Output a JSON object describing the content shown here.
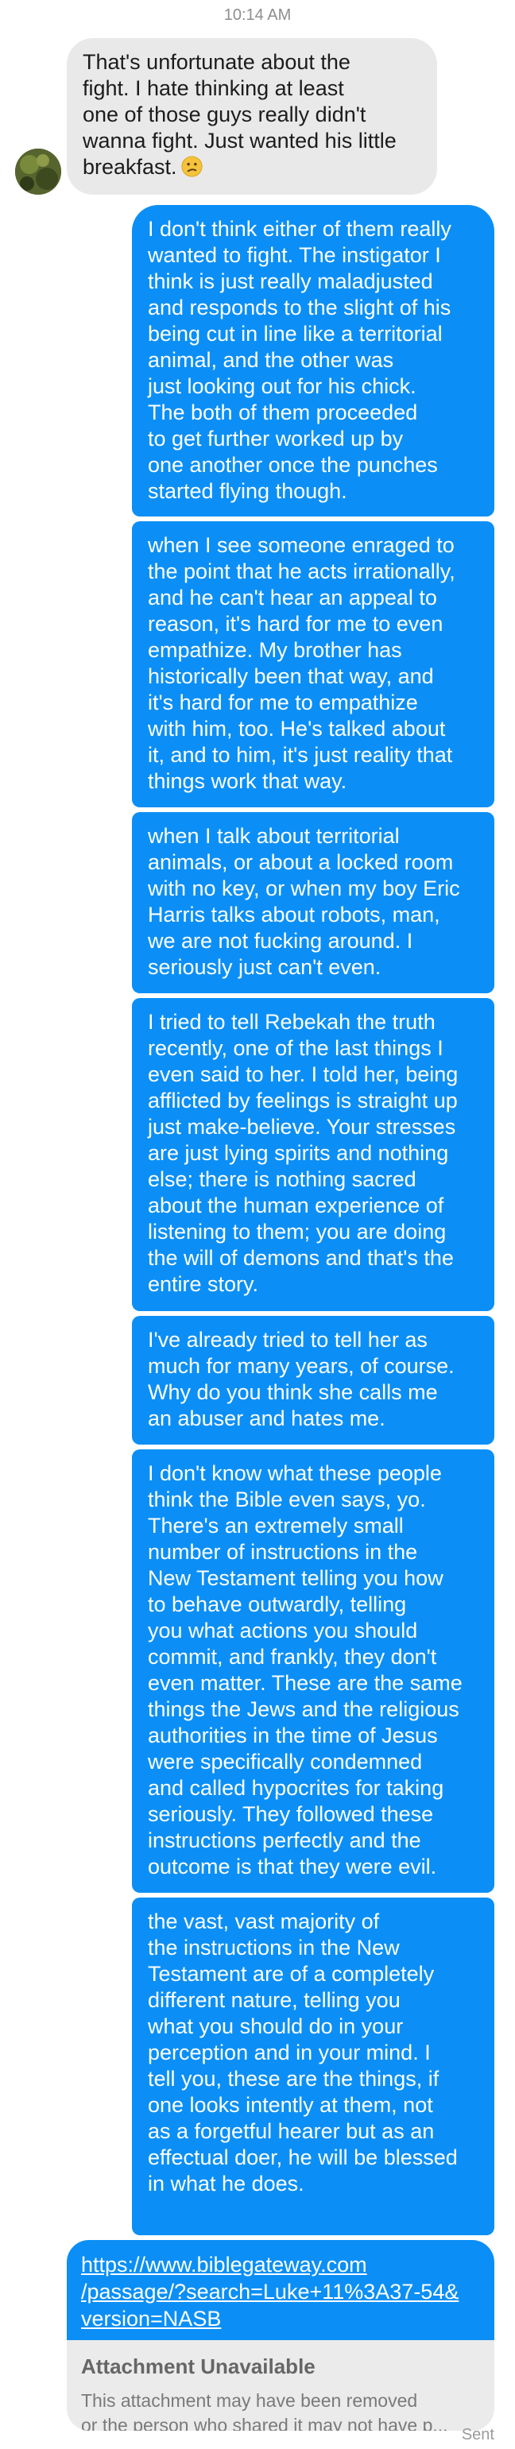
{
  "timestamp": "10:14 AM",
  "incoming": {
    "text": "That's unfortunate about the\nfight. I hate thinking at least\none of those guys really didn't\nwanna fight. Just wanted his little\nbreakfast.",
    "emoji": "confused-face"
  },
  "outgoing": [
    "I don't think either of them really\nwanted to fight. The instigator I\nthink is just really maladjusted\nand responds to the slight of his\nbeing cut in line like a territorial\nanimal, and the other was\njust looking out for his chick.\nThe both of them proceeded\nto get further worked up by\none another once the punches\nstarted flying though.",
    "when I see someone enraged to\nthe point that he acts irrationally,\nand he can't hear an appeal to\nreason, it's hard for me to even\nempathize. My brother has\nhistorically been that way, and\nit's hard for me to empathize\nwith him, too. He's talked about\nit, and to him, it's just reality that\nthings work that way.",
    "when I talk about territorial\nanimals, or about a locked room\nwith no key, or when my boy Eric\nHarris talks about robots, man,\nwe are not fucking around. I\nseriously just can't even.",
    "I tried to tell Rebekah the truth\nrecently, one of the last things I\neven said to her. I told her, being\nafflicted by feelings is straight up\njust make-believe. Your stresses\nare just lying spirits and nothing\nelse; there is nothing sacred\nabout the human experience of\nlistening to them; you are doing\nthe will of demons and that's the\nentire story.",
    "I've already tried to tell her as\nmuch for many years, of course.\nWhy do you think she calls me\nan abuser and hates me.",
    "I don't know what these people\nthink the Bible even says, yo.\nThere's an extremely small\nnumber of instructions in the\nNew Testament telling you how\nto behave outwardly, telling\nyou what actions you should\ncommit, and frankly, they don't\neven matter. These are the same\nthings the Jews and the religious\nauthorities in the time of Jesus\nwere specifically condemned\nand called hypocrites for taking\nseriously. They followed these\ninstructions perfectly and the\noutcome is that they were evil.",
    "the vast, vast majority of\nthe instructions in the New\nTestament are of a completely\ndifferent nature, telling you\nwhat you should do in your\nperception and in your mind. I\ntell you, these are the things, if\none looks intently at them, not\nas a forgetful hearer but as an\neffectual doer, he will be blessed\nin what he does."
  ],
  "link": {
    "line1": "https://www.biblegateway.com",
    "line2": "/passage/?search=Luke+11%3A37-54&",
    "line3": "version=NASB"
  },
  "attachment": {
    "title": "Attachment Unavailable",
    "desc_line1": "This attachment may have been removed",
    "desc_line2": "or the person who shared it may not have p..."
  },
  "status": "Sent",
  "colors": {
    "outgoing_bubble": "#0b8ff6",
    "incoming_bubble": "#e9e9e9"
  }
}
